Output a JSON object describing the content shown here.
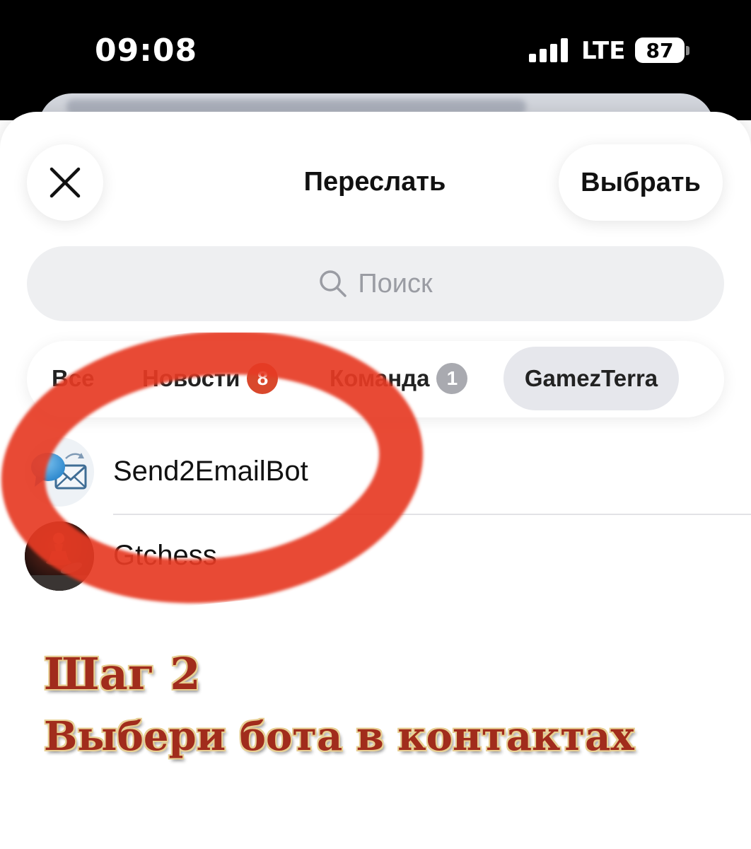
{
  "status_bar": {
    "time": "09:08",
    "network": "LTE",
    "battery": "87"
  },
  "header": {
    "close_icon": "close-icon",
    "title": "Переслать",
    "select_label": "Выбрать"
  },
  "search": {
    "icon": "search-icon",
    "placeholder": "Поиск"
  },
  "tabs": [
    {
      "label": "Все"
    },
    {
      "label": "Новости",
      "badge": "8",
      "badge_color": "#d9482c"
    },
    {
      "label": "Команда",
      "badge": "1",
      "badge_color": "#a9aab0"
    },
    {
      "label": "GamezTerra",
      "selected": true
    }
  ],
  "chats": [
    {
      "name": "Send2EmailBot",
      "avatar": "email-bot-icon"
    },
    {
      "name": "Gtchess",
      "avatar": "chess-pawn-avatar"
    }
  ],
  "caption": {
    "step": "Шаг 2",
    "hint": "Выбери бота в контактах"
  },
  "colors": {
    "marker": "#e63b22",
    "caption_text": "#a12c1c",
    "caption_outline": "#e7cf93"
  }
}
